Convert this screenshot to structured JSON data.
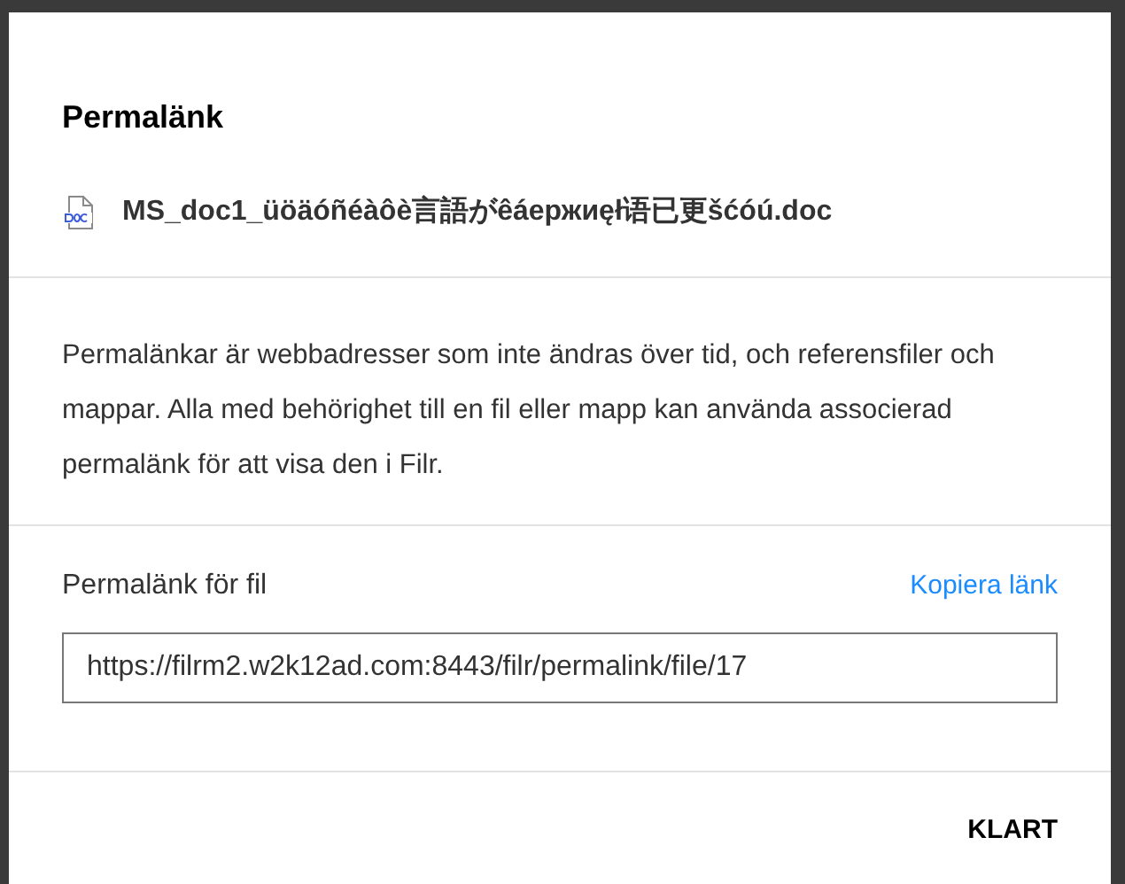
{
  "dialog": {
    "title": "Permalänk",
    "file_name": "MS_doc1_üöäóñéàôè言語がêáержиęł语已更šćóú.doc",
    "description": "Permalänkar är webbadresser som inte ändras över tid, och referensfiler och mappar. Alla med behörighet till en fil eller mapp kan använda associerad permalänk för att visa den i Filr.",
    "link_label": "Permalänk för fil",
    "copy_link": "Kopiera länk",
    "link_value": "https://filrm2.w2k12ad.com:8443/filr/permalink/file/17",
    "buttons": [
      "KLART"
    ]
  }
}
